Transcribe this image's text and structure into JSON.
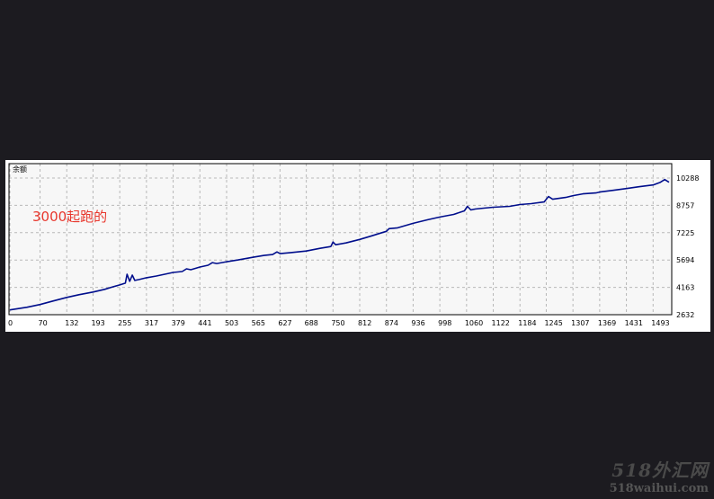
{
  "chart_data": {
    "type": "line",
    "title": "余额",
    "annotation": "3000起跑的",
    "x_ticks": [
      0,
      70,
      132,
      193,
      255,
      317,
      379,
      441,
      503,
      565,
      627,
      688,
      750,
      812,
      874,
      936,
      998,
      1060,
      1122,
      1184,
      1245,
      1307,
      1369,
      1431,
      1493
    ],
    "y_ticks": [
      2632,
      4163,
      5694,
      7225,
      8757,
      10288
    ],
    "xlim": [
      0,
      1530
    ],
    "ylim": [
      2632,
      10288
    ],
    "grid": true,
    "series": [
      {
        "color": "#000e8c",
        "x": [
          0,
          40,
          70,
          100,
          132,
          160,
          193,
          220,
          240,
          255,
          268,
          272,
          278,
          284,
          290,
          300,
          317,
          340,
          379,
          400,
          410,
          420,
          441,
          460,
          470,
          480,
          503,
          530,
          565,
          590,
          610,
          620,
          627,
          650,
          688,
          720,
          745,
          750,
          756,
          780,
          812,
          840,
          860,
          874,
          880,
          900,
          936,
          970,
          998,
          1030,
          1055,
          1062,
          1070,
          1080,
          1100,
          1122,
          1160,
          1184,
          1210,
          1240,
          1250,
          1260,
          1290,
          1307,
          1330,
          1360,
          1369,
          1400,
          1431,
          1460,
          1493,
          1510,
          1520,
          1530
        ],
        "y": [
          2900,
          3050,
          3200,
          3400,
          3600,
          3750,
          3900,
          4050,
          4200,
          4300,
          4400,
          4900,
          4500,
          4850,
          4550,
          4600,
          4700,
          4800,
          5000,
          5050,
          5200,
          5150,
          5300,
          5400,
          5550,
          5500,
          5600,
          5700,
          5850,
          5950,
          6000,
          6150,
          6050,
          6100,
          6200,
          6350,
          6450,
          6700,
          6550,
          6650,
          6850,
          7050,
          7200,
          7300,
          7450,
          7500,
          7750,
          7950,
          8100,
          8250,
          8450,
          8700,
          8500,
          8550,
          8600,
          8650,
          8700,
          8800,
          8850,
          8950,
          9250,
          9100,
          9200,
          9300,
          9400,
          9450,
          9500,
          9600,
          9700,
          9800,
          9900,
          10050,
          10200,
          10050
        ]
      }
    ]
  },
  "watermark": {
    "logo": "518外汇网",
    "url": "518waihui.com"
  }
}
